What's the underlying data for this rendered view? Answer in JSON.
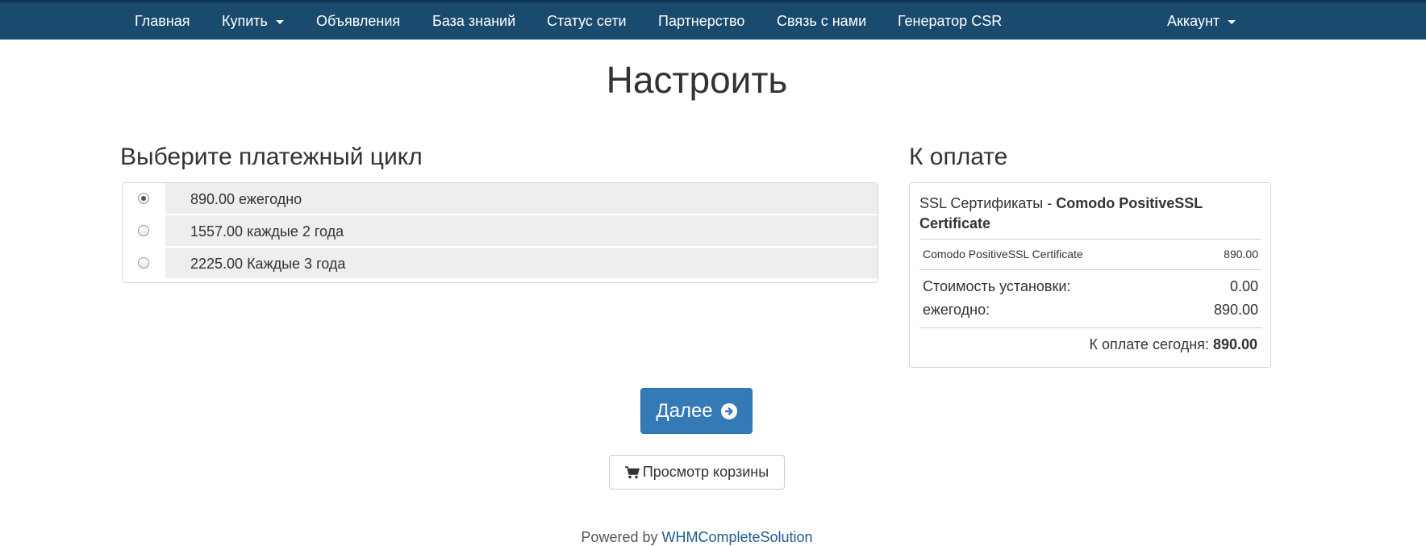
{
  "nav": {
    "home": "Главная",
    "buy": "Купить",
    "announcements": "Объявления",
    "knowledgebase": "База знаний",
    "network_status": "Статус сети",
    "partnership": "Партнерство",
    "contact": "Связь с нами",
    "csr_generator": "Генератор CSR",
    "account": "Аккаунт"
  },
  "page_title": "Настроить",
  "billing": {
    "heading": "Выберите платежный цикл",
    "options": [
      {
        "label": "890.00 ежегодно",
        "selected": true
      },
      {
        "label": "1557.00 каждые 2 года",
        "selected": false
      },
      {
        "label": "2225.00 Каждые 3 года",
        "selected": false
      }
    ]
  },
  "summary": {
    "heading": "К оплате",
    "product_group": "SSL Сертификаты - ",
    "product_name": "Comodo PositiveSSL Certificate",
    "line_item": {
      "name": "Comodo PositiveSSL Certificate",
      "price": "890.00"
    },
    "setup_fee_label": "Стоимость установки:",
    "setup_fee_value": "0.00",
    "cycle_label": "ежегодно:",
    "cycle_value": "890.00",
    "total_label": "К оплате сегодня: ",
    "total_value": "890.00"
  },
  "buttons": {
    "continue": "Далее",
    "view_cart": "Просмотр корзины"
  },
  "footer": {
    "prefix": "Powered by ",
    "link": "WHMCompleteSolution"
  },
  "colors": {
    "navbar": "#1a4a6e",
    "primary": "#337ab7",
    "link": "#1f5c8c"
  }
}
